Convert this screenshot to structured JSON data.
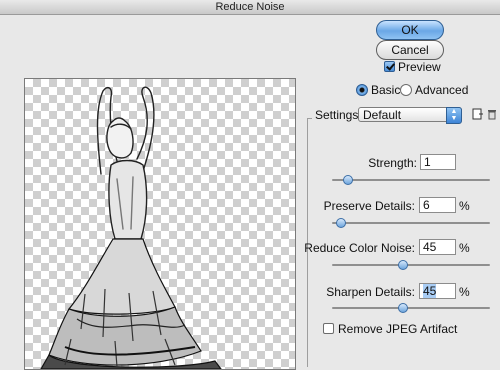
{
  "window": {
    "title": "Reduce Noise"
  },
  "buttons": {
    "ok": "OK",
    "cancel": "Cancel"
  },
  "preview_toggle": {
    "label": "Preview",
    "checked": true
  },
  "mode": {
    "basic": "Basic",
    "advanced": "Advanced",
    "selected": "Basic"
  },
  "settings": {
    "label": "Settings:",
    "value": "Default"
  },
  "params": [
    {
      "label": "Strength:",
      "value": "1",
      "unit": "",
      "level": 0.1
    },
    {
      "label": "Preserve Details:",
      "value": "6",
      "unit": "%",
      "level": 0.06
    },
    {
      "label": "Reduce Color Noise:",
      "value": "45",
      "unit": "%",
      "level": 0.45
    },
    {
      "label": "Sharpen Details:",
      "value": "45",
      "unit": "%",
      "level": 0.45
    }
  ],
  "remove_jpeg": {
    "label": "Remove JPEG Artifact",
    "checked": false
  },
  "icons": {
    "save_settings": "save-settings-icon",
    "delete_settings": "trash-icon"
  }
}
